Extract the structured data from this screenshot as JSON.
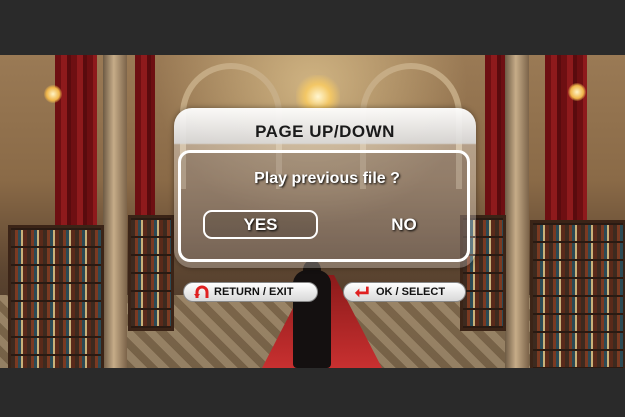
{
  "dialog": {
    "title": "PAGE UP/DOWN",
    "question": "Play previous file ?",
    "yes_label": "YES",
    "no_label": "NO"
  },
  "hints": {
    "return_label": "RETURN / EXIT",
    "ok_label": "OK / SELECT"
  },
  "colors": {
    "hint_icon_red": "#e02020",
    "dialog_text": "#ffffff"
  },
  "icons": {
    "return": "return-arrow-icon",
    "ok": "enter-arrow-icon"
  }
}
